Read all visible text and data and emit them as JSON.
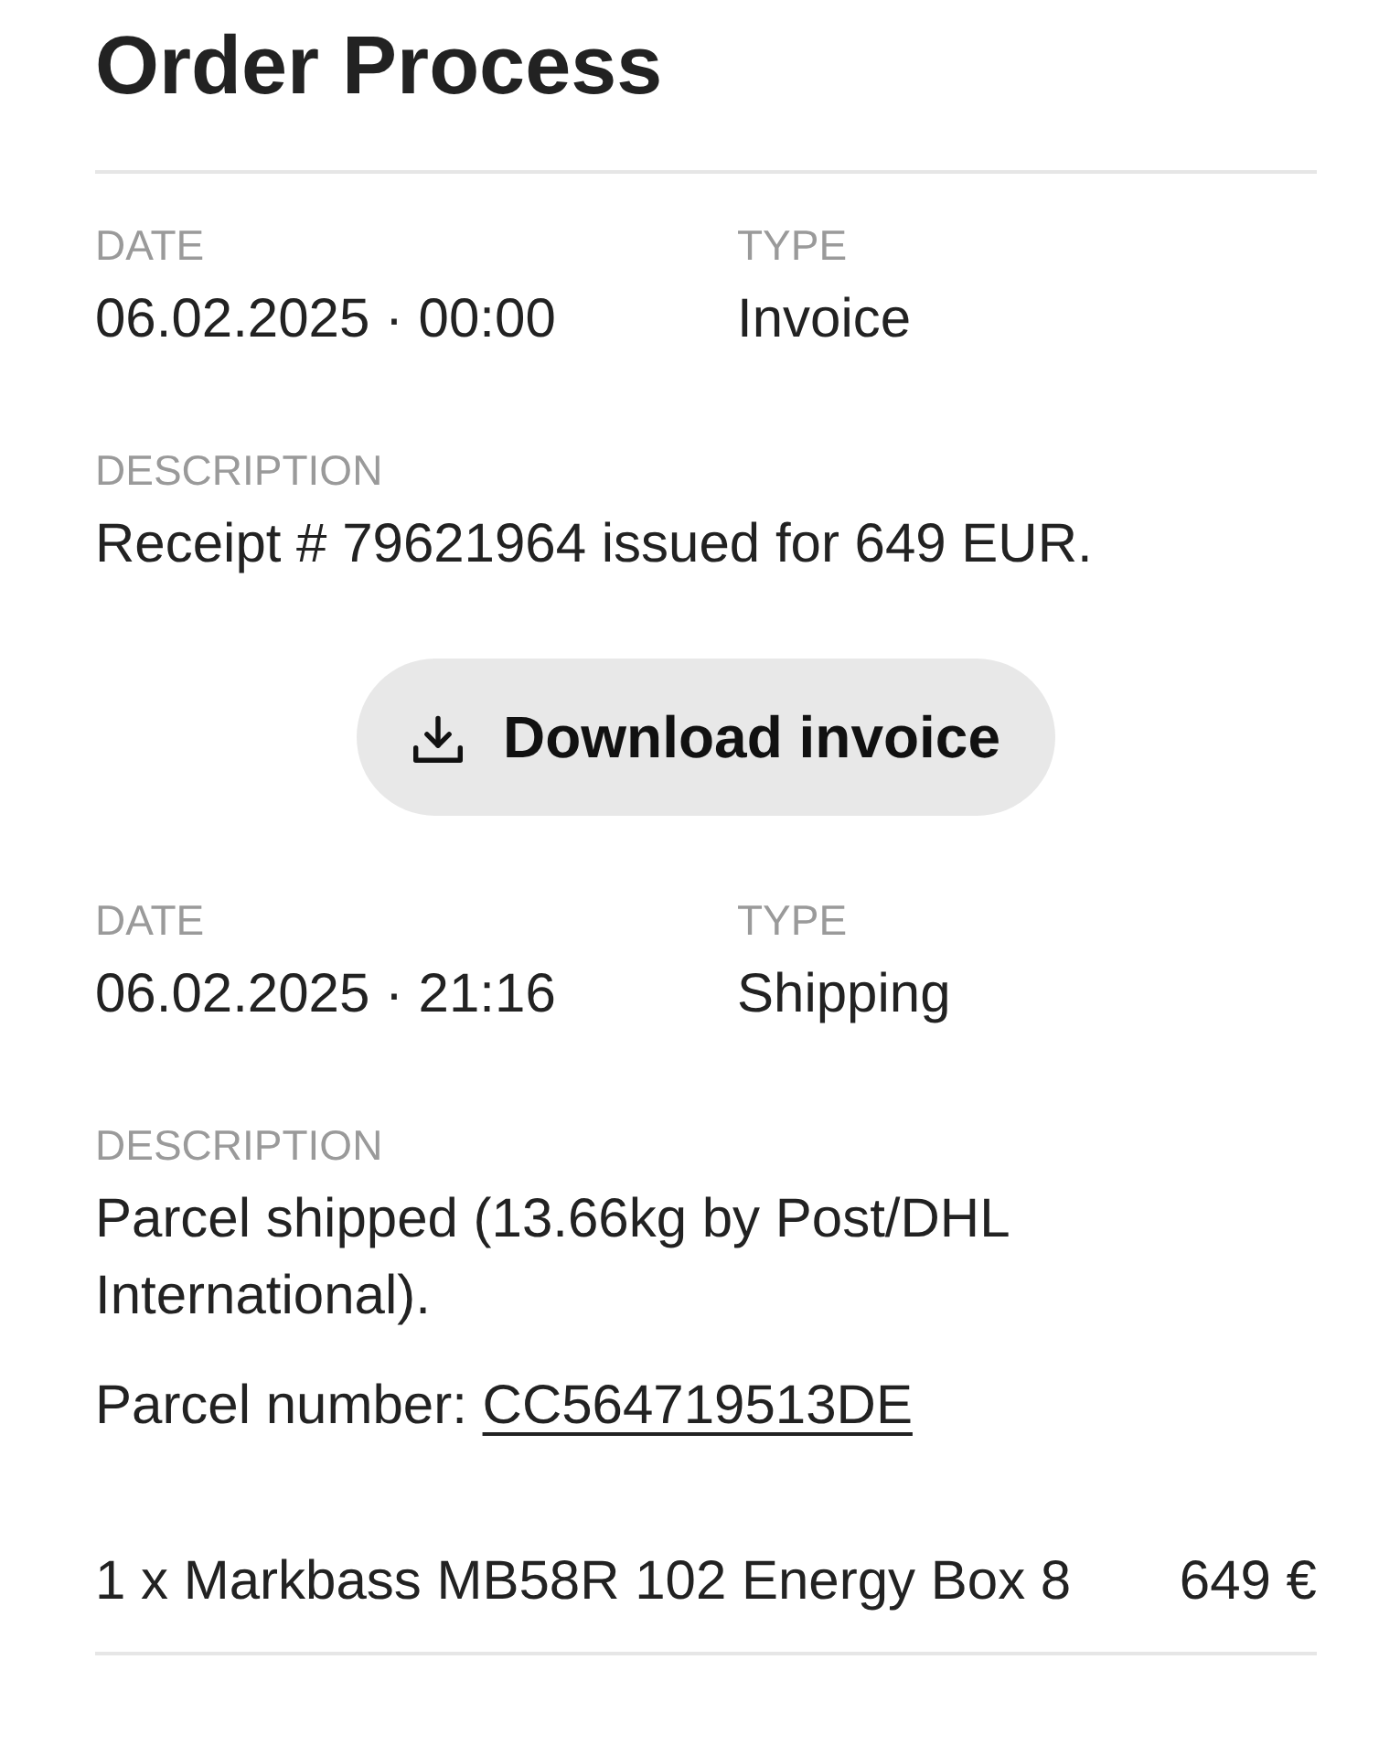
{
  "title": "Order Process",
  "events": [
    {
      "date_label": "DATE",
      "date": "06.02.2025 · 00:00",
      "type_label": "TYPE",
      "type": "Invoice",
      "description_label": "DESCRIPTION",
      "description": "Receipt # 79621964 issued for 649 EUR.",
      "action": {
        "label": "Download invoice"
      }
    },
    {
      "date_label": "DATE",
      "date": "06.02.2025 · 21:16",
      "type_label": "TYPE",
      "type": "Shipping",
      "description_label": "DESCRIPTION",
      "description": "Parcel shipped (13.66kg by Post/DHL International).",
      "tracking": {
        "label": "Parcel number:",
        "number": "CC564719513DE"
      }
    }
  ],
  "items": [
    {
      "name": "1 x Markbass MB58R 102 Energy Box 8",
      "price": "649 €"
    }
  ]
}
